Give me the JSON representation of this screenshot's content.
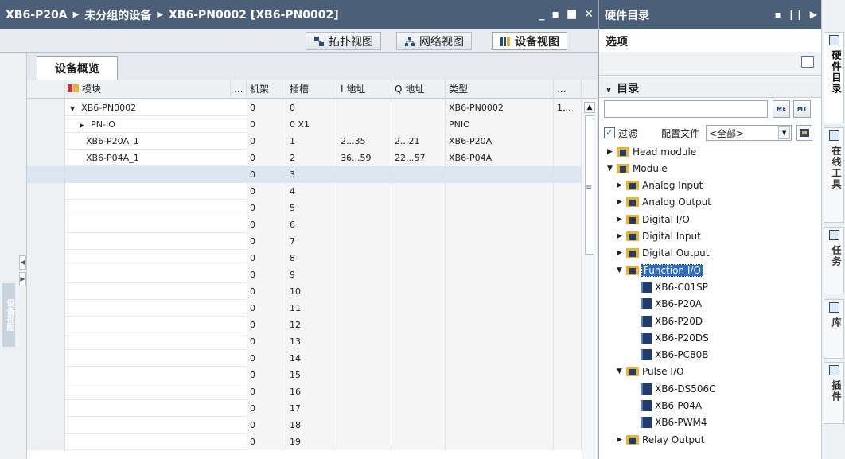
{
  "editor": {
    "breadcrumb": [
      "XB6-P20A",
      "未分组的设备",
      "XB6-PN0002 [XB6-PN0002]"
    ],
    "window_buttons": [
      "_",
      "▪",
      "■",
      "✕"
    ],
    "side_label": "设备视图",
    "views": {
      "topology": "拓扑视图",
      "network": "网络视图",
      "device": "设备视图"
    },
    "tab_overview": "设备概览",
    "columns": {
      "module": "模块",
      "ellipsis1": "...",
      "rack": "机架",
      "slot": "插槽",
      "iaddr": "I 地址",
      "qaddr": "Q 地址",
      "type": "类型",
      "ellipsis2": "..."
    },
    "rows": [
      {
        "module": "XB6-PN0002",
        "toggle": "▼",
        "indent": 0,
        "rack": "0",
        "slot": "0",
        "iaddr": "",
        "qaddr": "",
        "type": "XB6-PN0002",
        "more": "1..."
      },
      {
        "module": "PN-IO",
        "toggle": "▶",
        "indent": 1,
        "rack": "0",
        "slot": "0 X1",
        "iaddr": "",
        "qaddr": "",
        "type": "PNIO",
        "more": ""
      },
      {
        "module": "XB6-P20A_1",
        "toggle": "",
        "indent": 0,
        "rack": "0",
        "slot": "1",
        "iaddr": "2...35",
        "qaddr": "2...21",
        "type": "XB6-P20A",
        "more": ""
      },
      {
        "module": "XB6-P04A_1",
        "toggle": "",
        "indent": 0,
        "rack": "0",
        "slot": "2",
        "iaddr": "36...59",
        "qaddr": "22...57",
        "type": "XB6-P04A",
        "more": ""
      },
      {
        "module": "",
        "toggle": "",
        "indent": 0,
        "rack": "0",
        "slot": "3",
        "iaddr": "",
        "qaddr": "",
        "type": "",
        "more": "",
        "selected": true
      },
      {
        "module": "",
        "toggle": "",
        "indent": 0,
        "rack": "0",
        "slot": "4",
        "iaddr": "",
        "qaddr": "",
        "type": "",
        "more": ""
      },
      {
        "module": "",
        "toggle": "",
        "indent": 0,
        "rack": "0",
        "slot": "5",
        "iaddr": "",
        "qaddr": "",
        "type": "",
        "more": ""
      },
      {
        "module": "",
        "toggle": "",
        "indent": 0,
        "rack": "0",
        "slot": "6",
        "iaddr": "",
        "qaddr": "",
        "type": "",
        "more": ""
      },
      {
        "module": "",
        "toggle": "",
        "indent": 0,
        "rack": "0",
        "slot": "7",
        "iaddr": "",
        "qaddr": "",
        "type": "",
        "more": ""
      },
      {
        "module": "",
        "toggle": "",
        "indent": 0,
        "rack": "0",
        "slot": "8",
        "iaddr": "",
        "qaddr": "",
        "type": "",
        "more": ""
      },
      {
        "module": "",
        "toggle": "",
        "indent": 0,
        "rack": "0",
        "slot": "9",
        "iaddr": "",
        "qaddr": "",
        "type": "",
        "more": ""
      },
      {
        "module": "",
        "toggle": "",
        "indent": 0,
        "rack": "0",
        "slot": "10",
        "iaddr": "",
        "qaddr": "",
        "type": "",
        "more": ""
      },
      {
        "module": "",
        "toggle": "",
        "indent": 0,
        "rack": "0",
        "slot": "11",
        "iaddr": "",
        "qaddr": "",
        "type": "",
        "more": ""
      },
      {
        "module": "",
        "toggle": "",
        "indent": 0,
        "rack": "0",
        "slot": "12",
        "iaddr": "",
        "qaddr": "",
        "type": "",
        "more": ""
      },
      {
        "module": "",
        "toggle": "",
        "indent": 0,
        "rack": "0",
        "slot": "13",
        "iaddr": "",
        "qaddr": "",
        "type": "",
        "more": ""
      },
      {
        "module": "",
        "toggle": "",
        "indent": 0,
        "rack": "0",
        "slot": "14",
        "iaddr": "",
        "qaddr": "",
        "type": "",
        "more": ""
      },
      {
        "module": "",
        "toggle": "",
        "indent": 0,
        "rack": "0",
        "slot": "15",
        "iaddr": "",
        "qaddr": "",
        "type": "",
        "more": ""
      },
      {
        "module": "",
        "toggle": "",
        "indent": 0,
        "rack": "0",
        "slot": "16",
        "iaddr": "",
        "qaddr": "",
        "type": "",
        "more": ""
      },
      {
        "module": "",
        "toggle": "",
        "indent": 0,
        "rack": "0",
        "slot": "17",
        "iaddr": "",
        "qaddr": "",
        "type": "",
        "more": ""
      },
      {
        "module": "",
        "toggle": "",
        "indent": 0,
        "rack": "0",
        "slot": "18",
        "iaddr": "",
        "qaddr": "",
        "type": "",
        "more": ""
      },
      {
        "module": "",
        "toggle": "",
        "indent": 0,
        "rack": "0",
        "slot": "19",
        "iaddr": "",
        "qaddr": "",
        "type": "",
        "more": ""
      }
    ]
  },
  "catalog": {
    "title": "硬件目录",
    "options_header": "选项",
    "catalog_header": "目录",
    "search_value": "",
    "search_btn1": "ᴍᴇ",
    "search_btn2": "ᴍᴛ",
    "filter_label": "过滤",
    "filter_checked": true,
    "profile_label": "配置文件",
    "profile_value": "<全部>",
    "tree": [
      {
        "label": "Head module",
        "level": 0,
        "kind": "folder",
        "toggle": "▶"
      },
      {
        "label": "Module",
        "level": 0,
        "kind": "folder",
        "toggle": "▼"
      },
      {
        "label": "Analog Input",
        "level": 1,
        "kind": "folder",
        "toggle": "▶"
      },
      {
        "label": "Analog Output",
        "level": 1,
        "kind": "folder",
        "toggle": "▶"
      },
      {
        "label": "Digital I/O",
        "level": 1,
        "kind": "folder",
        "toggle": "▶"
      },
      {
        "label": "Digital Input",
        "level": 1,
        "kind": "folder",
        "toggle": "▶"
      },
      {
        "label": "Digital Output",
        "level": 1,
        "kind": "folder",
        "toggle": "▶"
      },
      {
        "label": "Function I/O",
        "level": 1,
        "kind": "folder",
        "toggle": "▼",
        "selected": true
      },
      {
        "label": "XB6-C01SP",
        "level": 2,
        "kind": "module",
        "toggle": ""
      },
      {
        "label": "XB6-P20A",
        "level": 2,
        "kind": "module",
        "toggle": ""
      },
      {
        "label": "XB6-P20D",
        "level": 2,
        "kind": "module",
        "toggle": ""
      },
      {
        "label": "XB6-P20DS",
        "level": 2,
        "kind": "module",
        "toggle": ""
      },
      {
        "label": "XB6-PC80B",
        "level": 2,
        "kind": "module",
        "toggle": ""
      },
      {
        "label": "Pulse I/O",
        "level": 1,
        "kind": "folder",
        "toggle": "▼"
      },
      {
        "label": "XB6-DS506C",
        "level": 2,
        "kind": "module",
        "toggle": ""
      },
      {
        "label": "XB6-P04A",
        "level": 2,
        "kind": "module",
        "toggle": ""
      },
      {
        "label": "XB6-PWM4",
        "level": 2,
        "kind": "module",
        "toggle": ""
      },
      {
        "label": "Relay Output",
        "level": 1,
        "kind": "folder",
        "toggle": "▶"
      }
    ]
  },
  "right_tabs": [
    {
      "label": "硬件目录",
      "active": true
    },
    {
      "label": "在线工具",
      "active": false
    },
    {
      "label": "任务",
      "active": false
    },
    {
      "label": "库",
      "active": false
    },
    {
      "label": "插件",
      "active": false
    }
  ]
}
